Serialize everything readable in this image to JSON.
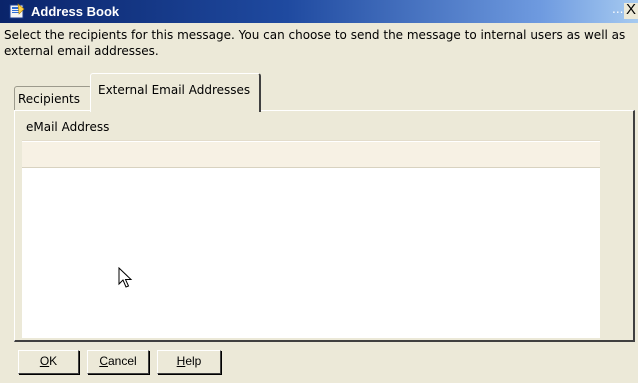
{
  "window": {
    "title": "Address Book",
    "ellipsis": "...",
    "close_glyph": "X",
    "icon": "address-book-icon"
  },
  "instructions": "Select the recipients for this message. You can choose to send the message to internal users as well as external email addresses.",
  "tabs": [
    {
      "label": "Recipients",
      "selected": false
    },
    {
      "label": "External Email Addresses",
      "selected": true
    }
  ],
  "grid": {
    "column_header": "eMail Address",
    "input_value": ""
  },
  "buttons": {
    "ok": {
      "mnemonic": "O",
      "rest": "K"
    },
    "cancel": {
      "mnemonic": "C",
      "rest": "ancel"
    },
    "help": {
      "mnemonic": "H",
      "rest": "elp"
    }
  },
  "colors": {
    "titlebar_start": "#0a246a",
    "titlebar_end": "#a6caf0",
    "dialog_bg": "#ece9d8",
    "grid_bg": "#ffffff"
  }
}
